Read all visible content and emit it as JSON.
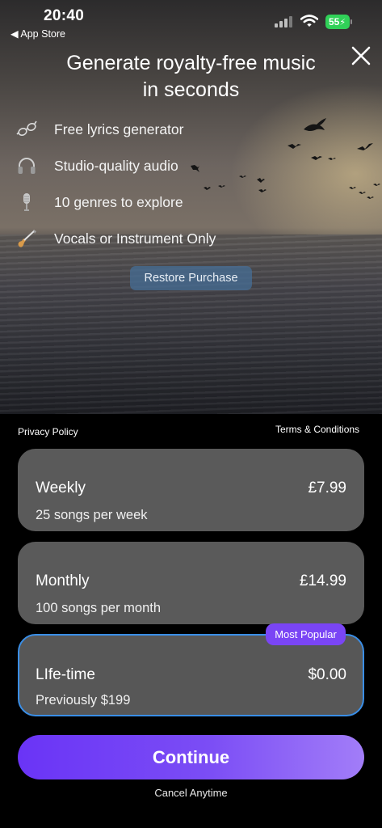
{
  "status_bar": {
    "time": "20:40",
    "back_label": "◀ App Store",
    "battery": "55"
  },
  "hero": {
    "title_line1": "Generate royalty-free music",
    "title_line2": "in seconds",
    "features": [
      {
        "icon": "glasses-icon",
        "label": "Free lyrics generator"
      },
      {
        "icon": "headphones-icon",
        "label": "Studio-quality audio"
      },
      {
        "icon": "microphone-icon",
        "label": "10 genres to explore"
      },
      {
        "icon": "guitar-icon",
        "label": "Vocals or Instrument Only"
      }
    ],
    "restore_label": "Restore Purchase"
  },
  "links": {
    "privacy": "Privacy Policy",
    "terms": "Terms & Conditions"
  },
  "plans": [
    {
      "name": "Weekly",
      "price": "£7.99",
      "desc": "25 songs per week",
      "selected": false
    },
    {
      "name": "Monthly",
      "price": "£14.99",
      "desc": "100 songs per month",
      "selected": false
    },
    {
      "name": "LIfe-time",
      "price": "$0.00",
      "desc": "Previously $199",
      "selected": true,
      "badge": "Most Popular"
    }
  ],
  "cta": {
    "label": "Continue",
    "subtext": "Cancel Anytime"
  },
  "colors": {
    "accent": "#7a45f5",
    "selected_border": "#3a8ee6",
    "card": "#5a5a5a",
    "battery": "#30d158"
  }
}
